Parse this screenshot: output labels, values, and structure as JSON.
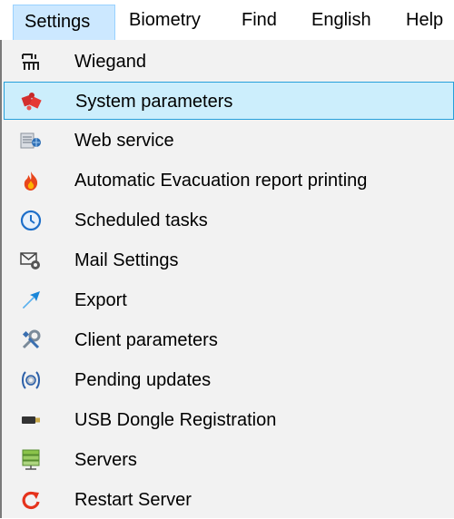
{
  "menubar": {
    "items": [
      {
        "label": "Settings"
      },
      {
        "label": "Biometry"
      },
      {
        "label": "Find"
      },
      {
        "label": "English"
      },
      {
        "label": "Help"
      }
    ]
  },
  "dropdown": {
    "items": [
      {
        "label": "Wiegand",
        "icon": "wiegand-icon"
      },
      {
        "label": "System parameters",
        "icon": "puzzle-icon",
        "hovered": true
      },
      {
        "label": "Web service",
        "icon": "web-service-icon"
      },
      {
        "label": "Automatic Evacuation report printing",
        "icon": "fire-icon"
      },
      {
        "label": "Scheduled tasks",
        "icon": "clock-icon"
      },
      {
        "label": "Mail Settings",
        "icon": "mail-gear-icon"
      },
      {
        "label": "Export",
        "icon": "export-arrow-icon"
      },
      {
        "label": "Client parameters",
        "icon": "tools-icon"
      },
      {
        "label": "Pending updates",
        "icon": "update-gear-icon"
      },
      {
        "label": "USB Dongle Registration",
        "icon": "usb-dongle-icon"
      },
      {
        "label": "Servers",
        "icon": "servers-icon"
      },
      {
        "label": "Restart Server",
        "icon": "restart-icon"
      }
    ]
  },
  "colors": {
    "active_menu_bg": "#cce8ff",
    "hover_item_bg": "#cceefc",
    "hover_item_border": "#26a0da",
    "dropdown_bg": "#f2f2f2"
  }
}
